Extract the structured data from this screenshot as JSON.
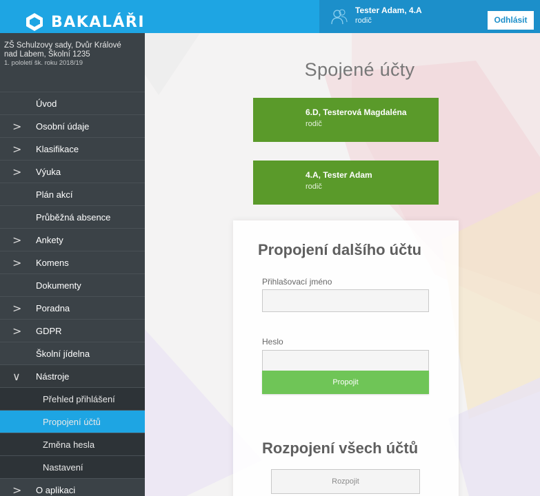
{
  "header": {
    "brand": "BAKALÁŘI",
    "user_name": "Tester Adam, 4.A",
    "user_role": "rodič",
    "logout_label": "Odhlásit"
  },
  "school": {
    "name": "ZŠ Schulzovy sady, Dvůr Králové nad Labem, Školní 1235",
    "term": "1. pololetí šk. roku 2018/19"
  },
  "nav": {
    "items": [
      {
        "label": "Úvod",
        "chevron": ""
      },
      {
        "label": "Osobní údaje",
        "chevron": ">"
      },
      {
        "label": "Klasifikace",
        "chevron": ">"
      },
      {
        "label": "Výuka",
        "chevron": ">"
      },
      {
        "label": "Plán akcí",
        "chevron": ""
      },
      {
        "label": "Průběžná absence",
        "chevron": ""
      },
      {
        "label": "Ankety",
        "chevron": ">"
      },
      {
        "label": "Komens",
        "chevron": ">"
      },
      {
        "label": "Dokumenty",
        "chevron": ""
      },
      {
        "label": "Poradna",
        "chevron": ">"
      },
      {
        "label": "GDPR",
        "chevron": ">"
      },
      {
        "label": "Školní jídelna",
        "chevron": ""
      },
      {
        "label": "Nástroje",
        "chevron": "∨"
      },
      {
        "label": "Přehled přihlášení",
        "chevron": ""
      },
      {
        "label": "Propojení účtů",
        "chevron": ""
      },
      {
        "label": "Změna hesla",
        "chevron": ""
      },
      {
        "label": "Nastavení",
        "chevron": ""
      },
      {
        "label": "O aplikaci",
        "chevron": ">"
      }
    ]
  },
  "main": {
    "title": "Spojené účty",
    "accounts": [
      {
        "name": "6.D, Testerová Magdaléna",
        "role": "rodič"
      },
      {
        "name": "4.A, Tester Adam",
        "role": "rodič"
      }
    ],
    "connect_title": "Propojení dalšího účtu",
    "login_label": "Přihlašovací jméno",
    "login_value": "",
    "password_label": "Heslo",
    "password_value": "",
    "connect_button": "Propojit",
    "disconnect_title": "Rozpojení všech účtů",
    "disconnect_button": "Rozpojit"
  },
  "colors": {
    "header_blue": "#1ea5e3",
    "user_block_blue": "#1c8fca",
    "sidebar_dark": "#3b4247",
    "sidebar_active": "#1ea5e3",
    "account_green": "#5a9a2a",
    "connect_green": "#6fc557"
  },
  "icons": {
    "logo": "bakalari-logo-icon",
    "user": "user-avatar-icon"
  }
}
